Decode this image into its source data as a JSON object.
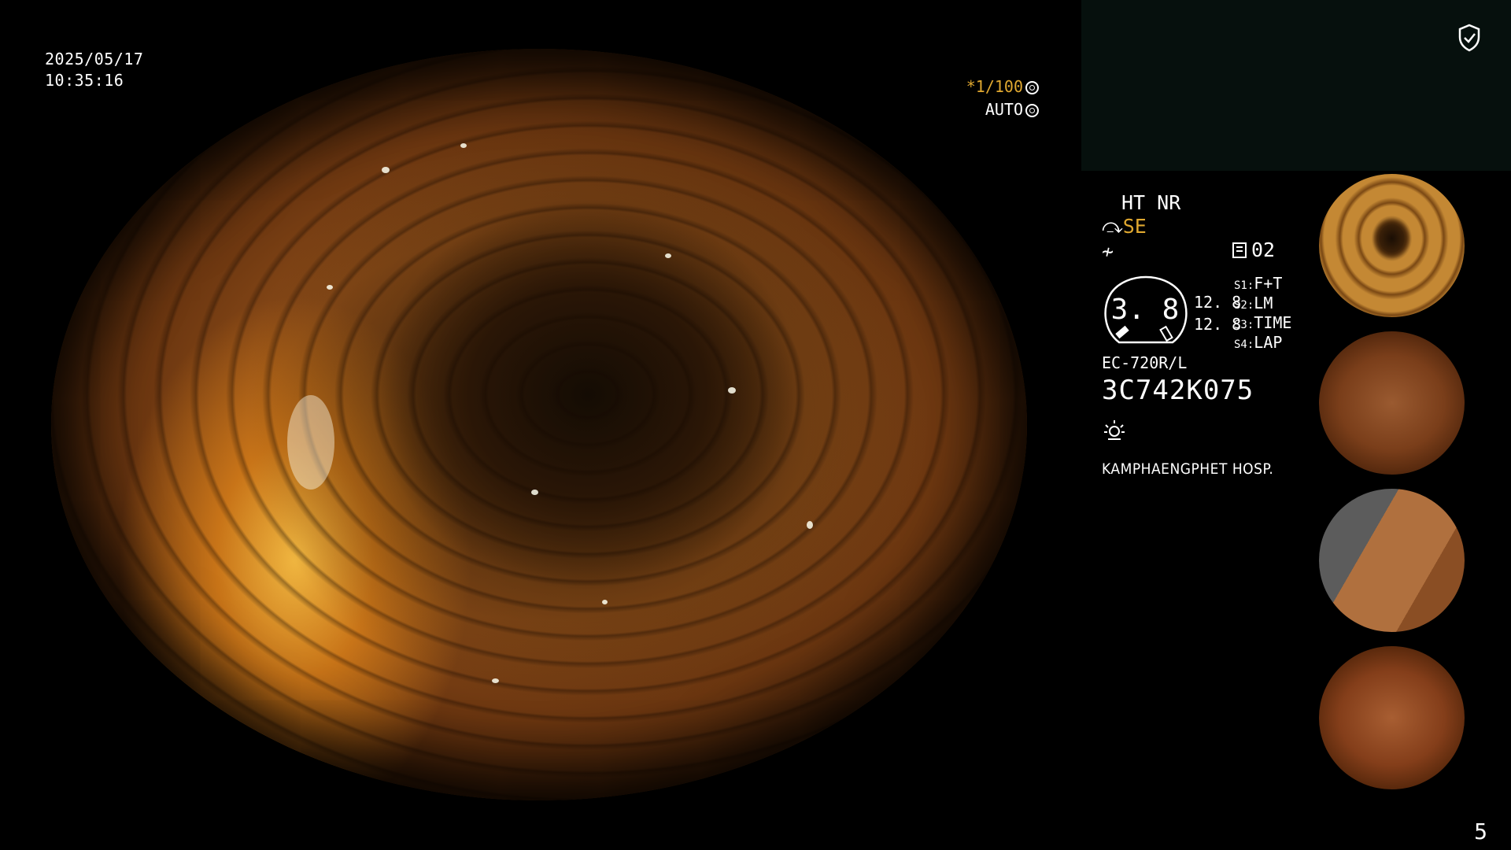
{
  "overlay": {
    "date": "2025/05/17",
    "time": "10:35:16",
    "shutter": "*1/100",
    "iris_mode": "AUTO"
  },
  "settings": {
    "ht_nr": "HT NR",
    "se_label": "SE",
    "memory_label": "02"
  },
  "gauge": {
    "value": "3. 8",
    "distance_1": "12. 8",
    "distance_2": "12. 8"
  },
  "switches": [
    {
      "key": "S1:",
      "value": "F+T"
    },
    {
      "key": "S2:",
      "value": "LM"
    },
    {
      "key": "S3:",
      "value": "TIME"
    },
    {
      "key": "S4:",
      "value": "LAP"
    }
  ],
  "scope": {
    "model": "EC-720R/L",
    "serial": "3C742K075"
  },
  "hospital": "KAMPHAENGPHET HOSP.",
  "page_number": "5",
  "icons": {
    "shield": "shield-check-icon",
    "shutter": "aperture-icon",
    "iris": "iris-icon",
    "se": "scope-angle-icon",
    "f": "flash-icon",
    "memory": "memory-icon",
    "light": "light-icon"
  },
  "colors": {
    "accent": "#e0a830",
    "text": "#ffffff",
    "background": "#000000",
    "preview_box": "#06100d"
  }
}
